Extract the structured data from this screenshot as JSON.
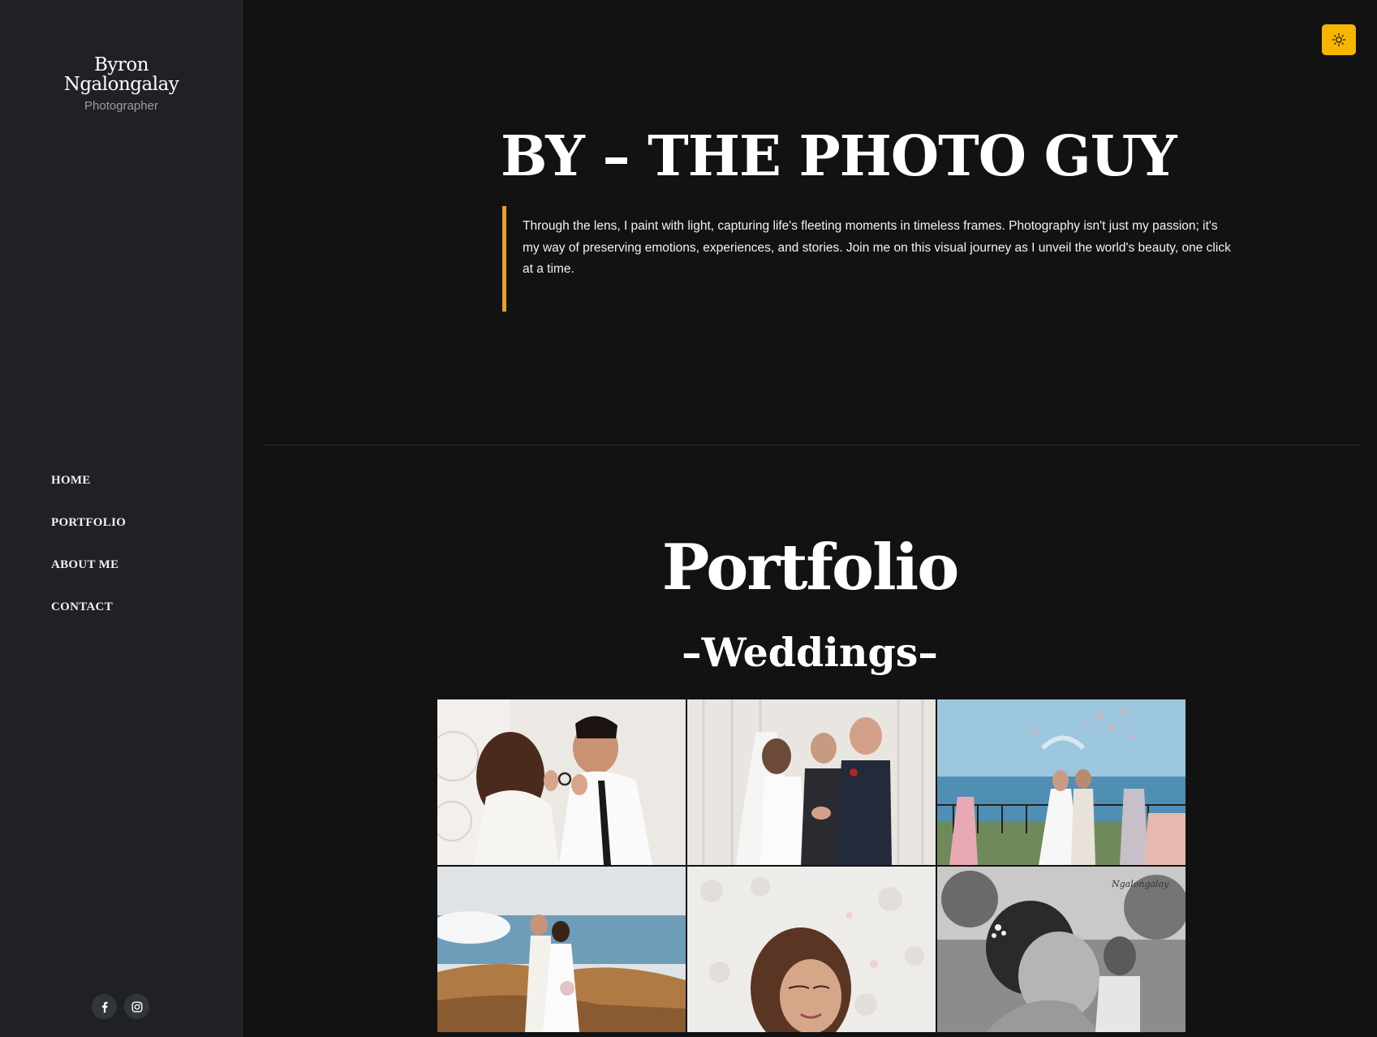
{
  "sidebar": {
    "brand_name": "Byron Ngalongalay",
    "brand_role": "Photographer",
    "nav": [
      {
        "label": "HOME"
      },
      {
        "label": "PORTFOLIO"
      },
      {
        "label": "ABOUT ME"
      },
      {
        "label": "CONTACT"
      }
    ],
    "socials": [
      {
        "icon": "facebook-icon"
      },
      {
        "icon": "instagram-icon"
      }
    ]
  },
  "header": {
    "theme_toggle_icon": "sun-icon",
    "accent_color": "#f7b500"
  },
  "hero": {
    "title": "BY – THE PHOTO GUY",
    "text": "Through the lens, I paint with light, capturing life's fleeting moments in timeless frames. Photography isn't just my passion; it's my way of preserving emotions, experiences, and stories. Join me on this visual journey as I unveil the world's beauty, one click at a time.",
    "quote_bar_color": "#e6a02a"
  },
  "portfolio": {
    "title": "Portfolio",
    "category": "–Weddings–",
    "photos": [
      {
        "subject": "couple kissing holding ring"
      },
      {
        "subject": "wedding ceremony with officiant"
      },
      {
        "subject": "seaside ceremony petal toss"
      },
      {
        "subject": "couple on rocky beach"
      },
      {
        "subject": "bride portrait floral wall"
      },
      {
        "subject": "black and white bride portrait"
      }
    ]
  }
}
